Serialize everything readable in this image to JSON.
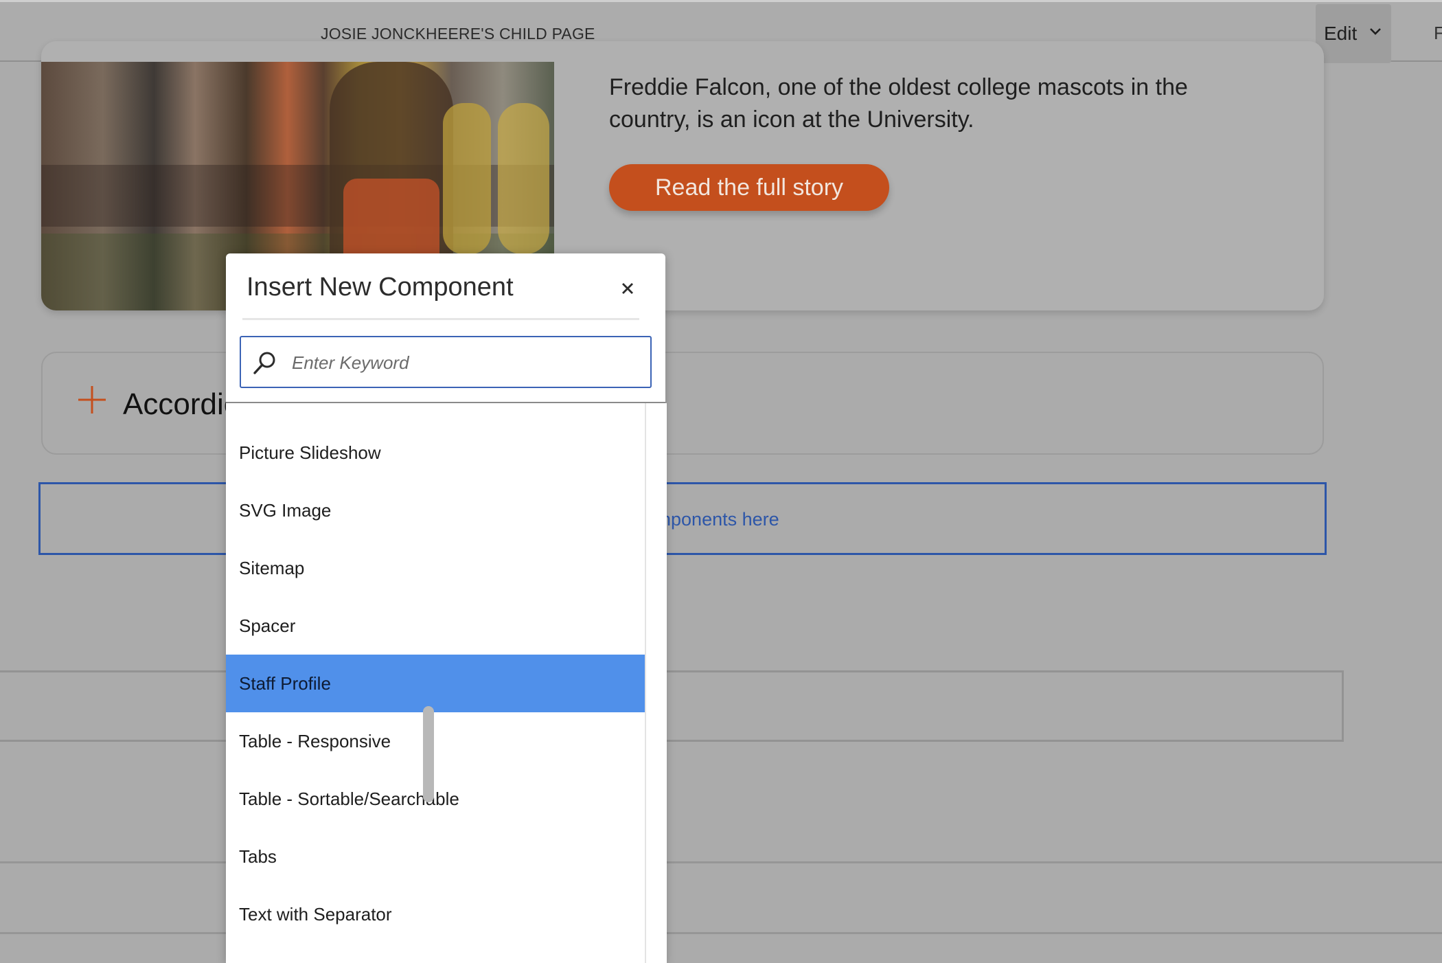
{
  "topbar": {
    "page_title": "JOSIE JONCKHEERE'S CHILD PAGE",
    "mode_label": "Edit",
    "right_partial": "F"
  },
  "story": {
    "body": "Freddie Falcon, one of the oldest college mascots in the country, is an icon at the University.",
    "cta_label": "Read the full story"
  },
  "accordion": {
    "title": "Accordic"
  },
  "drop_zone": {
    "label": "nponents here"
  },
  "dialog": {
    "title": "Insert New Component",
    "search_placeholder": "Enter Keyword",
    "items": [
      {
        "label": "Picture Slideshow",
        "selected": false
      },
      {
        "label": "SVG Image",
        "selected": false
      },
      {
        "label": "Sitemap",
        "selected": false
      },
      {
        "label": "Spacer",
        "selected": false
      },
      {
        "label": "Staff Profile",
        "selected": true
      },
      {
        "label": "Table - Responsive",
        "selected": false
      },
      {
        "label": "Table - Sortable/Searchable",
        "selected": false
      },
      {
        "label": "Tabs",
        "selected": false
      },
      {
        "label": "Text with Separator",
        "selected": false
      }
    ]
  },
  "colors": {
    "accent_orange": "#c44f1d",
    "selection_blue": "#5090ea",
    "focus_blue": "#3b63b5",
    "overlay_gray": "#ababab"
  }
}
